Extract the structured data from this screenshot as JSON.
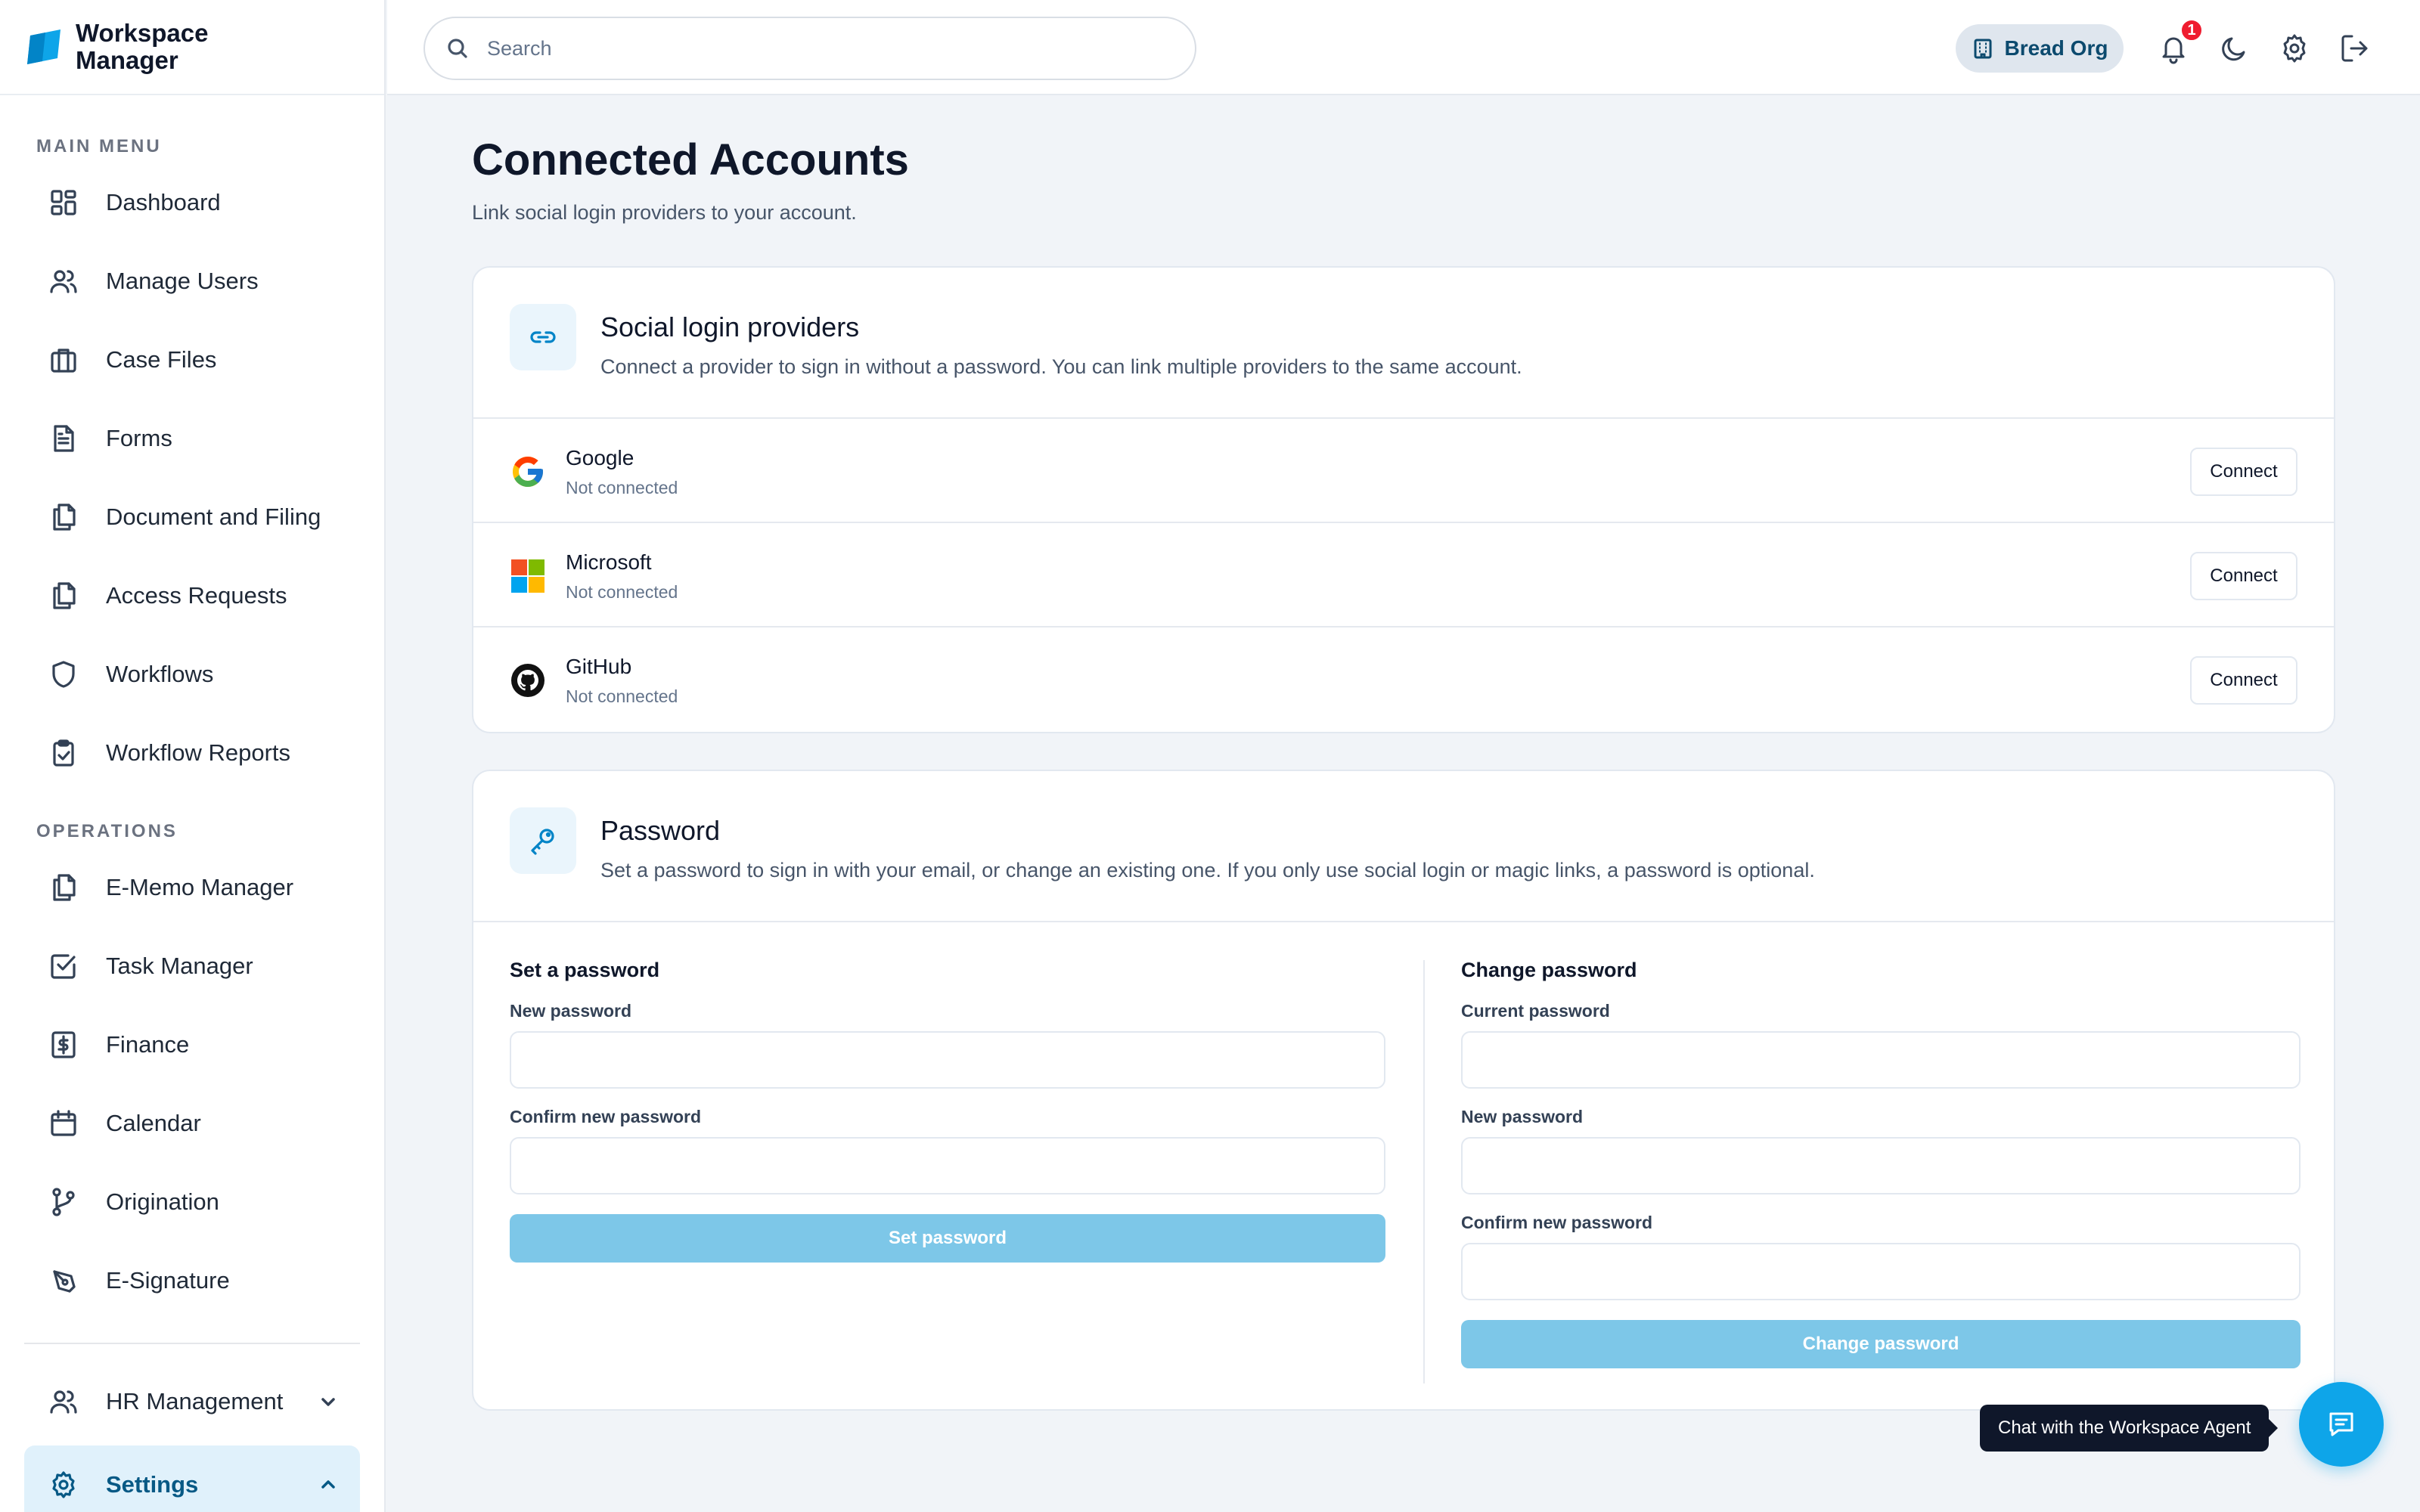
{
  "brand": {
    "line1": "Workspace",
    "line2": "Manager",
    "logo_icon": "workspace-logo-icon"
  },
  "sidebar": {
    "main_label": "MAIN MENU",
    "main_items": [
      {
        "label": "Dashboard",
        "icon": "dashboard-icon"
      },
      {
        "label": "Manage Users",
        "icon": "users-icon"
      },
      {
        "label": "Case Files",
        "icon": "briefcase-icon"
      },
      {
        "label": "Forms",
        "icon": "file-text-icon"
      },
      {
        "label": "Document and Filing",
        "icon": "files-icon"
      },
      {
        "label": "Access Requests",
        "icon": "files-icon"
      },
      {
        "label": "Workflows",
        "icon": "shield-icon"
      },
      {
        "label": "Workflow Reports",
        "icon": "clipboard-check-icon"
      }
    ],
    "ops_label": "OPERATIONS",
    "ops_items": [
      {
        "label": "E-Memo Manager",
        "icon": "files-icon"
      },
      {
        "label": "Task Manager",
        "icon": "check-square-icon"
      },
      {
        "label": "Finance",
        "icon": "dollar-icon"
      },
      {
        "label": "Calendar",
        "icon": "calendar-icon"
      },
      {
        "label": "Origination",
        "icon": "git-branch-icon"
      },
      {
        "label": "E-Signature",
        "icon": "pen-tool-icon"
      }
    ],
    "hr_label": "HR Management",
    "settings_label": "Settings"
  },
  "topbar": {
    "search_placeholder": "Search",
    "org_label": "Bread Org",
    "notification_count": "1"
  },
  "page": {
    "title": "Connected Accounts",
    "subtitle": "Link social login providers to your account."
  },
  "social": {
    "title": "Social login providers",
    "description": "Connect a provider to sign in without a password. You can link multiple providers to the same account.",
    "providers": [
      {
        "name": "Google",
        "status": "Not connected",
        "button": "Connect",
        "icon": "google-icon"
      },
      {
        "name": "Microsoft",
        "status": "Not connected",
        "button": "Connect",
        "icon": "microsoft-icon"
      },
      {
        "name": "GitHub",
        "status": "Not connected",
        "button": "Connect",
        "icon": "github-icon"
      }
    ]
  },
  "password": {
    "title": "Password",
    "description": "Set a password to sign in with your email, or change an existing one. If you only use social login or magic links, a password is optional.",
    "set": {
      "title": "Set a password",
      "new_label": "New password",
      "confirm_label": "Confirm new password",
      "button": "Set password"
    },
    "change": {
      "title": "Change password",
      "current_label": "Current password",
      "new_label": "New password",
      "confirm_label": "Confirm new password",
      "button": "Change password"
    }
  },
  "chat": {
    "tooltip": "Chat with the Workspace Agent"
  },
  "colors": {
    "accent": "#0ea5e9",
    "button_disabled": "#7dc7e8",
    "badge": "#ef1c2f",
    "active_bg": "#e0f1fb"
  }
}
